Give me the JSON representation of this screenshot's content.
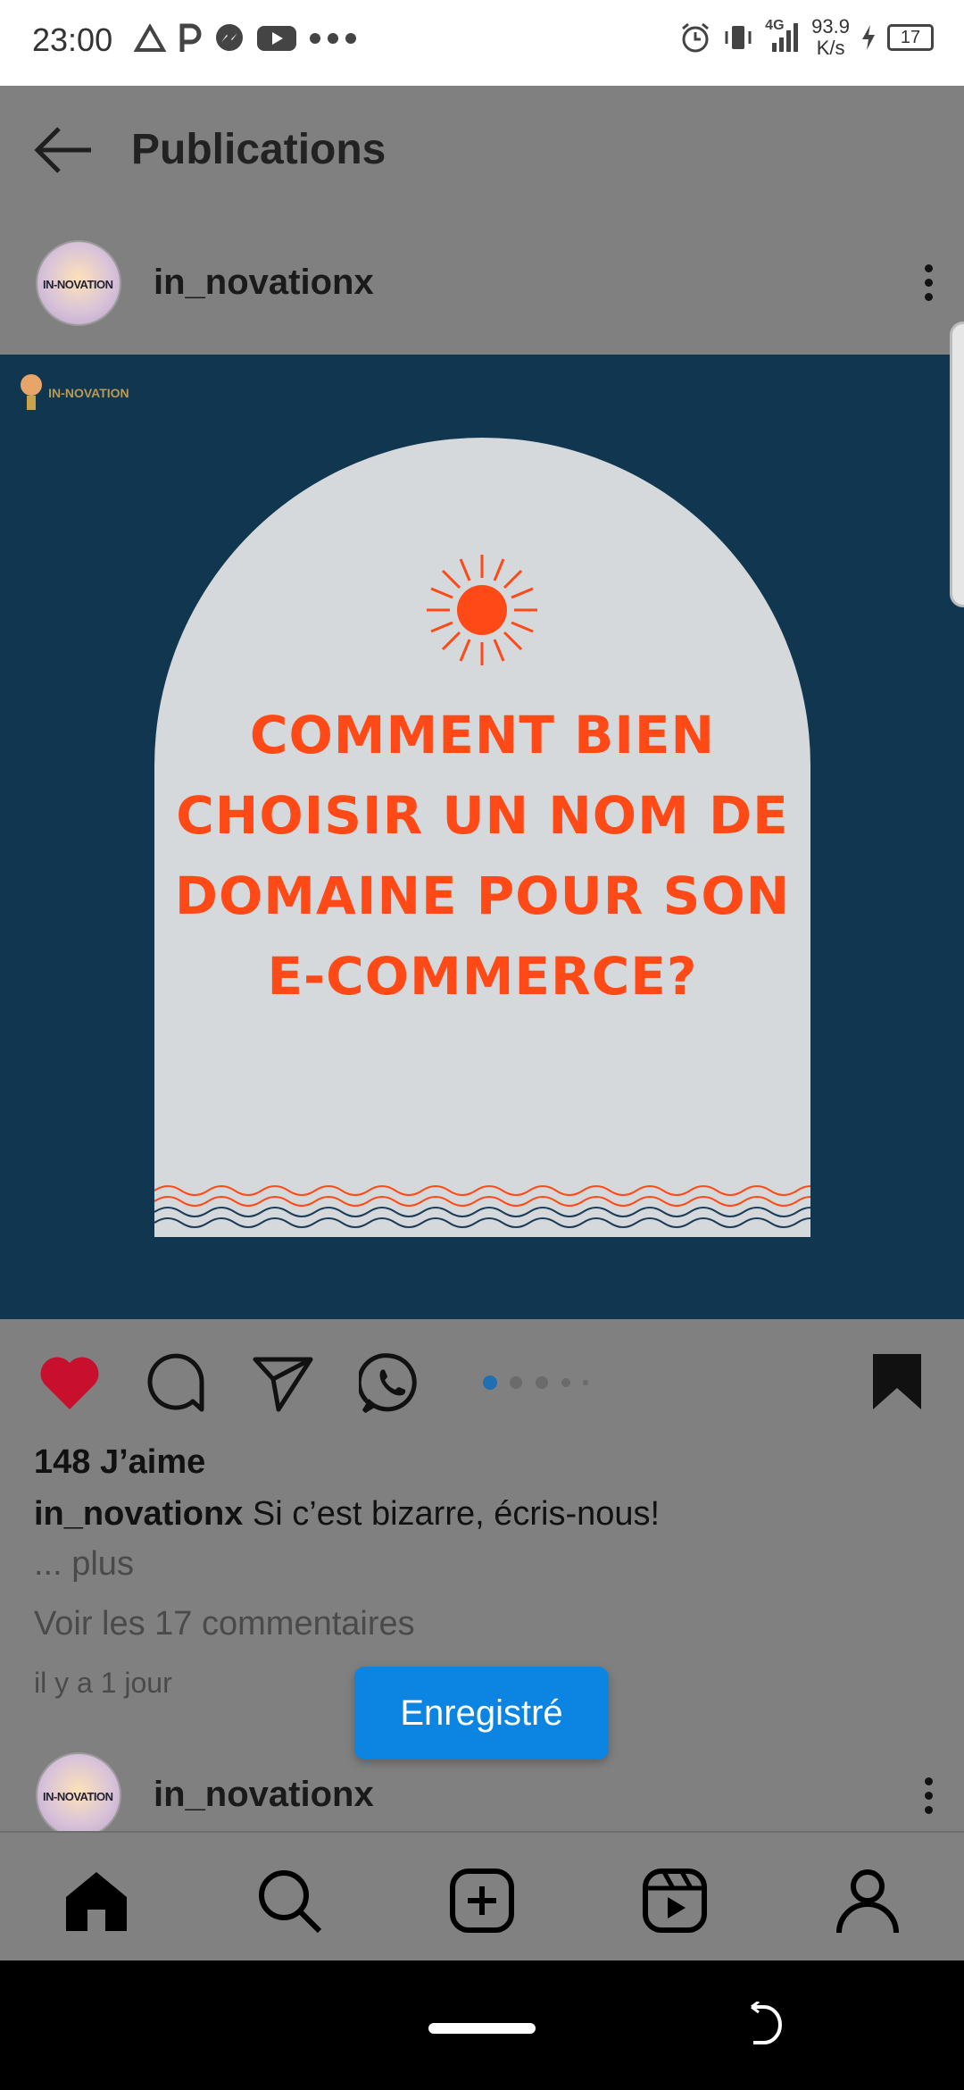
{
  "status_bar": {
    "time": "23:00",
    "network_type": "4G",
    "speed_value": "93.9",
    "speed_unit": "K/s",
    "battery": "17",
    "icons": [
      "drive-icon",
      "parking-icon",
      "messenger-icon",
      "youtube-icon",
      "more-dots-icon",
      "alarm-icon",
      "vibrate-icon",
      "signal-icon",
      "charging-icon",
      "battery-icon"
    ]
  },
  "app_bar": {
    "title": "Publications",
    "back_icon": "arrow-left-icon"
  },
  "post": {
    "username": "in_novationx",
    "avatar_text": "IN-NOVATION",
    "image": {
      "logo_text": "IN-NOVATION",
      "background": "#11364f",
      "card_color": "#d6d9db",
      "accent": "#ff4a17",
      "headline_lines": [
        "COMMENT BIEN",
        "CHOISIR UN NOM DE",
        "DOMAINE POUR SON",
        "E-COMMERCE?"
      ]
    },
    "carousel_pages": 5,
    "carousel_active": 1,
    "likes": "148 J’aime",
    "caption_user": "in_novationx",
    "caption_text": " Si c’est bizarre, écris-nous!",
    "more_label": "... plus",
    "comments_link": "Voir les 17 commentaires",
    "timestamp": "il y a 1 jour",
    "liked": true,
    "saved": true
  },
  "toast": {
    "label": "Enregistré"
  },
  "next_post": {
    "username": "in_novationx",
    "avatar_text": "IN-NOVATION"
  },
  "bottom_nav": [
    "home-icon",
    "search-icon",
    "add-post-icon",
    "reels-icon",
    "profile-icon"
  ],
  "colors": {
    "like_red": "#c8102e",
    "toast_blue": "#0b84e2",
    "dim_overlay": "#808080"
  }
}
